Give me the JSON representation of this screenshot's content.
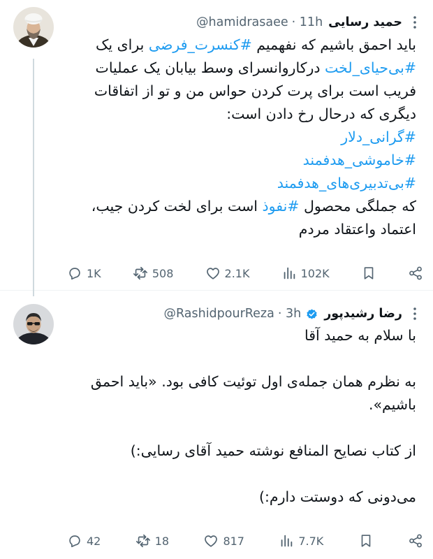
{
  "tweets": [
    {
      "author_name": "حمید رسایی",
      "handle": "@hamidrasaee",
      "time": "· 11h",
      "verified": false,
      "body": [
        [
          {
            "t": "باید احمق باشیم که نفهمیم "
          },
          {
            "tag": "#کنسرت_فرضی"
          },
          {
            "t": " برای یک"
          }
        ],
        [
          {
            "tag": "#بی‌حیای_لخت"
          },
          {
            "t": " درکاروانسرای وسط بیابان یک عملیات"
          }
        ],
        [
          {
            "t": "فریب است برای پرت کردن حواس من و تو از اتفاقات"
          }
        ],
        [
          {
            "t": "دیگری که درحال رخ دادن است:"
          }
        ],
        [
          {
            "tag": "#گرانی_دلار"
          }
        ],
        [
          {
            "tag": "#خاموشی_هدفمند"
          }
        ],
        [
          {
            "tag": "#بی‌تدبیری‌های_هدفمند"
          }
        ],
        [
          {
            "t": "که جملگی محصول "
          },
          {
            "tag": "#نفوذ"
          },
          {
            "t": " است برای لخت کردن جیب،"
          }
        ],
        [
          {
            "t": "اعتماد واعتقاد مردم"
          }
        ]
      ],
      "stats": {
        "replies": "1K",
        "reposts": "508",
        "likes": "2.1K",
        "views": "102K"
      }
    },
    {
      "author_name": "رضا رشیدپور",
      "handle": "@RashidpourReza",
      "time": "· 3h",
      "verified": true,
      "body": [
        [
          {
            "t": "با سلام به حمید آقا"
          }
        ],
        [],
        [
          {
            "t": "به نظرم همان جمله‌ی اول توئیت کافی بود. «باید احمق"
          }
        ],
        [
          {
            "t": "باشیم»."
          }
        ],
        [],
        [
          {
            "t": "از کتاب نصایح المنافع نوشته حمید آقای رسایی:)"
          }
        ],
        [],
        [
          {
            "t": "می‌دونی که دوستت دارم:)"
          }
        ]
      ],
      "stats": {
        "replies": "42",
        "reposts": "18",
        "likes": "817",
        "views": "7.7K"
      }
    }
  ],
  "colors": {
    "link": "#1d9bf0",
    "muted": "#536471",
    "text": "#0f1419",
    "verified": "#1d9bf0"
  },
  "icons": [
    "reply-icon",
    "repost-icon",
    "like-icon",
    "views-icon",
    "bookmark-icon",
    "share-icon",
    "more-icon",
    "verified-badge-icon"
  ]
}
